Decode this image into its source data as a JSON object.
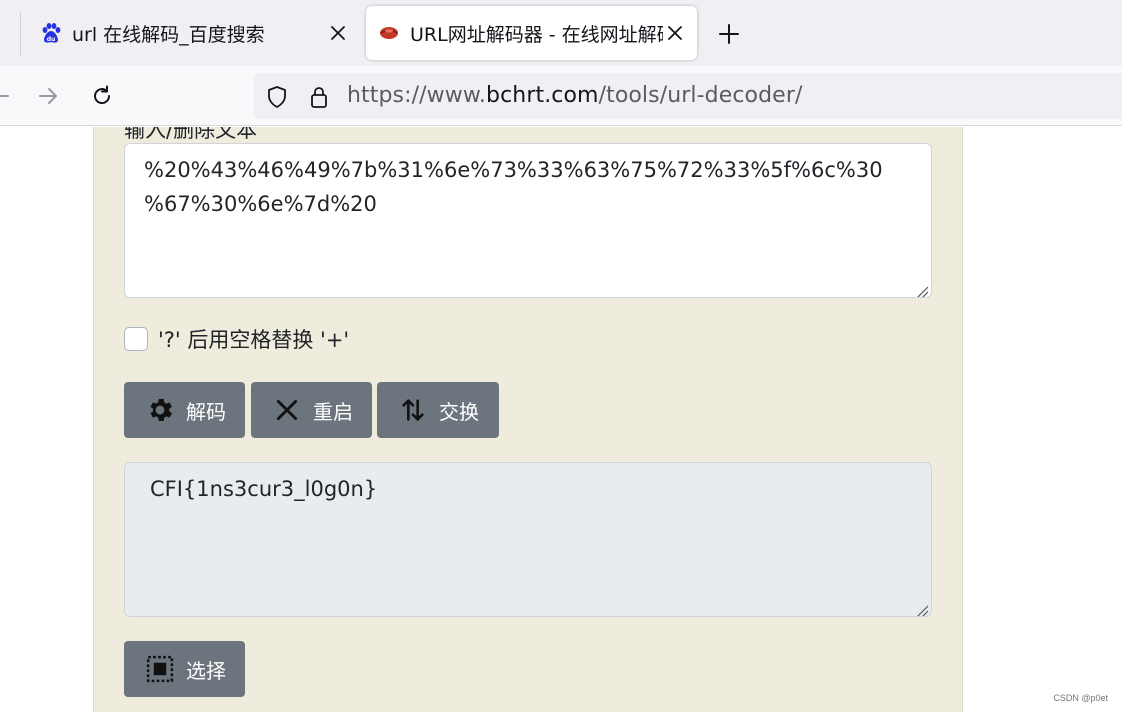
{
  "browser": {
    "tabs": [
      {
        "title": "url 在线解码_百度搜索",
        "favicon": "baidu-paw-icon",
        "active": false
      },
      {
        "title": "URL网址解码器 - 在线网址解码",
        "favicon": "bchrt-lips-icon",
        "active": true
      }
    ],
    "url": {
      "prefix": "https://www.",
      "domain": "bchrt.com",
      "path": "/tools/url-decoder/"
    }
  },
  "page": {
    "input_label": "输入/删除文本",
    "input_lines": [
      "%20%43%46%49%7b%31%6e%73%33%63%75%72%33%5f%6c%30",
      "%67%30%6e%7d%20"
    ],
    "checkbox_label": "'?' 后用空格替换 '+'",
    "checkbox_checked": false,
    "buttons": {
      "decode": "解码",
      "reset": "重启",
      "swap": "交换",
      "select": "选择"
    },
    "output_text": "CFI{1ns3cur3_l0g0n}"
  },
  "watermark": "CSDN @p0et",
  "colors": {
    "panel_bg": "#efecdd",
    "button_bg": "#6c757d",
    "output_bg": "#e9ecef"
  }
}
